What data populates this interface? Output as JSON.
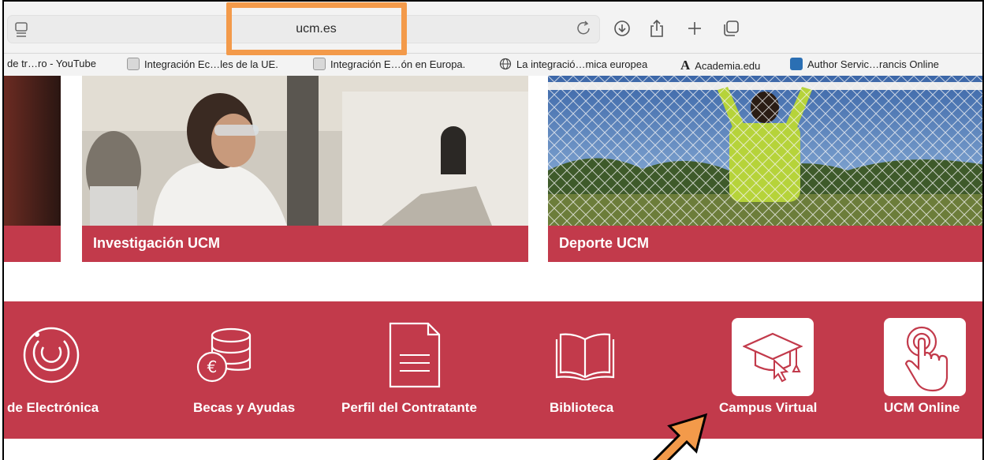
{
  "browser": {
    "url": "ucm.es"
  },
  "bookmarks": [
    {
      "label": "de tr…ro - YouTube",
      "icon": "none"
    },
    {
      "label": "Integración Ec…les de la UE.",
      "icon": "doc-favicon"
    },
    {
      "label": "Integración E…ón en Europa.",
      "icon": "doc-favicon"
    },
    {
      "label": "La integració…mica europea",
      "icon": "globe-icon"
    },
    {
      "label": "Academia.edu",
      "icon": "academia-a-icon"
    },
    {
      "label": "Author Servic…rancis Online",
      "icon": "cloud-favicon"
    }
  ],
  "cards": [
    {
      "caption": "Investigación UCM"
    },
    {
      "caption": "Deporte UCM"
    }
  ],
  "services": [
    {
      "label": "de Electrónica",
      "icon": "circle-power-icon"
    },
    {
      "label": "Becas y Ayudas",
      "icon": "coins-euro-icon"
    },
    {
      "label": "Perfil del Contratante",
      "icon": "document-icon"
    },
    {
      "label": "Biblioteca",
      "icon": "open-book-icon"
    },
    {
      "label": "Campus Virtual",
      "icon": "graduation-cap-cursor-icon"
    },
    {
      "label": "UCM Online",
      "icon": "hand-tap-icon"
    }
  ],
  "colors": {
    "brand_red": "#c23a4b",
    "highlight_orange": "#f39a4a"
  }
}
